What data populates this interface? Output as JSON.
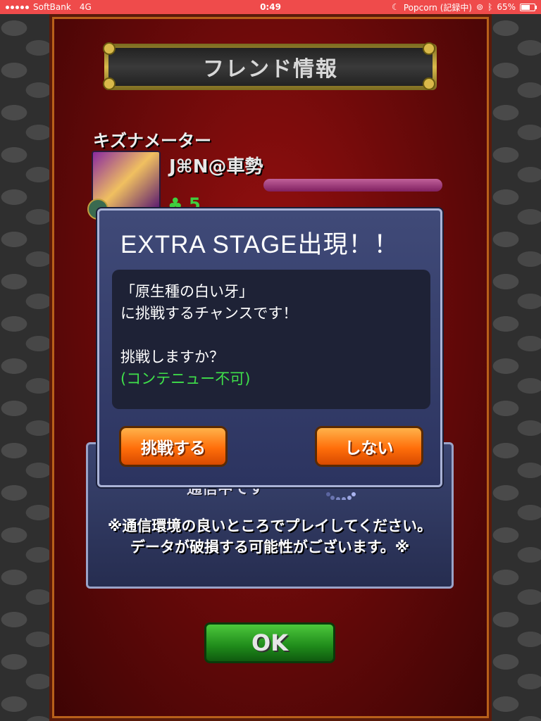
{
  "status_bar": {
    "carrier": "SoftBank",
    "network": "4G",
    "time": "0:49",
    "app_status": "Popcorn (記録中)",
    "battery": "65%",
    "battery_level": 0.65
  },
  "friend_screen": {
    "title": "フレンド情報",
    "kizuna_label": "キズナメーター",
    "friend_name": "J⌘N@車勢",
    "friend_count": "5"
  },
  "connection_dialog": {
    "connecting_text": "通信中です",
    "note_line1": "※通信環境の良いところでプレイしてください。",
    "note_line2": "データが破損する可能性がございます。※"
  },
  "extra_stage_dialog": {
    "title": "EXTRA STAGE出現！！",
    "line1": "「原生種の白い牙」",
    "line2": "に挑戦するチャンスです！",
    "line3": "挑戦しますか？",
    "line4": "(コンテニュー不可)",
    "challenge_button": "挑戦する",
    "decline_button": "しない"
  },
  "ok_button": "OK"
}
